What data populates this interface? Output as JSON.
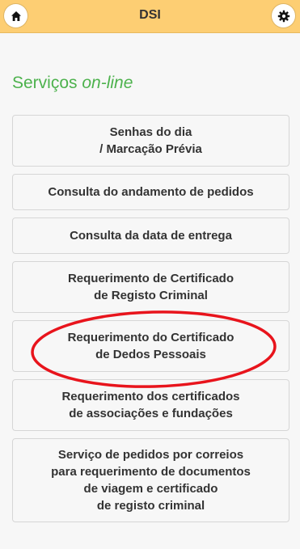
{
  "header": {
    "title": "DSI",
    "home_icon": "home-icon",
    "settings_icon": "gear-icon",
    "bar_color": "#fdce73"
  },
  "section": {
    "title_prefix": "Serviços ",
    "title_emphasis": "on-line",
    "title_color": "#4db24d"
  },
  "menu": {
    "items": [
      {
        "label": "Senhas do dia\n/ Marcação Prévia"
      },
      {
        "label": "Consulta do andamento de pedidos"
      },
      {
        "label": "Consulta da data de entrega"
      },
      {
        "label": "Requerimento de Certificado\nde Registo Criminal"
      },
      {
        "label": "Requerimento do Certificado\nde Dedos Pessoais"
      },
      {
        "label": "Requerimento dos certificados\nde associações e fundações"
      },
      {
        "label": "Serviço de pedidos por correios\npara requerimento de documentos\nde viagem e certificado\nde registo criminal"
      }
    ]
  },
  "annotation": {
    "shape": "ellipse",
    "color": "#e8141c"
  }
}
